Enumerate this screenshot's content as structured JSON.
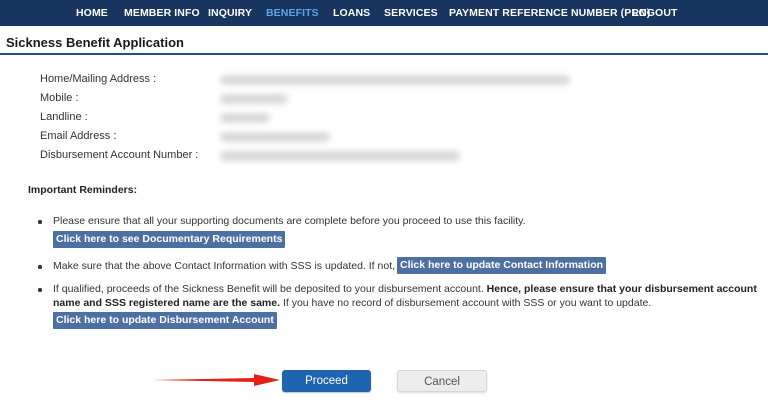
{
  "nav": {
    "items": [
      {
        "label": "HOME"
      },
      {
        "label": "MEMBER INFO"
      },
      {
        "label": "INQUIRY"
      },
      {
        "label": "BENEFITS",
        "active": true
      },
      {
        "label": "LOANS"
      },
      {
        "label": "SERVICES"
      },
      {
        "label": "PAYMENT REFERENCE NUMBER (PRN)"
      },
      {
        "label": "LOGOUT"
      }
    ],
    "background": "#17355e",
    "active_color": "#5aa6e6"
  },
  "page": {
    "title": "Sickness Benefit Application"
  },
  "info": {
    "rows": [
      {
        "label": "Home/Mailing Address :"
      },
      {
        "label": "Mobile :"
      },
      {
        "label": "Landline :"
      },
      {
        "label": "Email Address :"
      },
      {
        "label": "Disbursement Account Number :"
      }
    ],
    "values_redacted": true
  },
  "reminders": {
    "title": "Important Reminders:",
    "item1": {
      "text": "Please ensure that all your supporting documents are complete before you proceed to use this facility.",
      "link": "Click here to see Documentary Requirements",
      "after": "."
    },
    "item2": {
      "text": "Make sure that the above Contact Information with SSS is updated. If not,",
      "link": "Click here to update Contact Information",
      "after": "."
    },
    "item3": {
      "text_normal": "If qualified, proceeds of the Sickness Benefit will be deposited to your disbursement account.",
      "text_bold_1": "Hence, please ensure that your disbursement account",
      "text_bold_2": "name and SSS registered name are the same.",
      "text_normal_2": "If you have no record of disbursement account with SSS or you want to update.",
      "link": "Click here to update Disbursement Account",
      "after": "."
    }
  },
  "actions": {
    "proceed_label": "Proceed",
    "cancel_label": "Cancel",
    "proceed_color": "#1f64b1",
    "annotation_arrow_color": "#e8201a"
  }
}
